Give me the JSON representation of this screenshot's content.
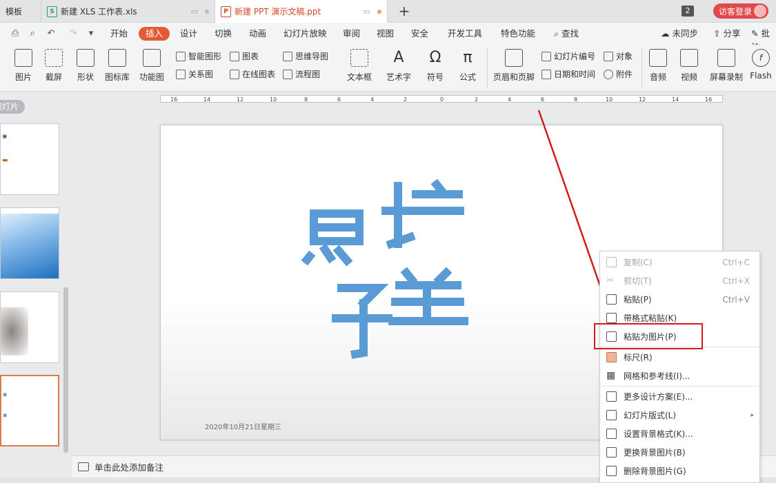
{
  "tabs": {
    "tab1": "模板",
    "tab2": "新建 XLS 工作表.xls",
    "tab3": "新建 PPT 演示文稿.ppt",
    "window_count": "2",
    "login": "访客登录"
  },
  "menu": {
    "items": [
      "开始",
      "插入",
      "设计",
      "切换",
      "动画",
      "幻灯片放映",
      "审阅",
      "视图",
      "安全",
      "开发工具",
      "特色功能"
    ],
    "search": "查找",
    "sync": "未同步",
    "share": "分享",
    "annotate": "批注"
  },
  "ribbon": {
    "picture": "图片",
    "screenshot": "截屏",
    "shapes": "形状",
    "icon_lib": "图标库",
    "func_chart": "功能图",
    "smart_shape": "智能图形",
    "chart": "图表",
    "relation": "关系图",
    "online_chart": "在线图表",
    "mindmap": "思维导图",
    "flowchart": "流程图",
    "textbox": "文本框",
    "art_text": "艺术字",
    "symbol": "符号",
    "formula": "公式",
    "header_footer": "页眉和页脚",
    "slide_number": "幻灯片编号",
    "object": "对象",
    "date_time": "日期和时间",
    "attachment": "附件",
    "audio": "音频",
    "video": "视频",
    "screen_record": "屏幕录制",
    "flash": "Flash"
  },
  "left_panel": {
    "tab_label": "幻灯片"
  },
  "ruler": {
    "ticks": [
      "16",
      "14",
      "12",
      "10",
      "8",
      "6",
      "4",
      "2",
      "0",
      "2",
      "4",
      "6",
      "8",
      "10",
      "12",
      "14",
      "16"
    ]
  },
  "slide": {
    "date": "2020年10月21日星期三"
  },
  "notes": {
    "placeholder": "单击此处添加备注"
  },
  "context_menu": {
    "copy": "复制(C)",
    "copy_shortcut": "Ctrl+C",
    "cut": "剪切(T)",
    "cut_shortcut": "Ctrl+X",
    "paste": "粘贴(P)",
    "paste_shortcut": "Ctrl+V",
    "paste_format": "带格式粘贴(K)",
    "paste_picture": "粘贴为图片(P)",
    "ruler": "标尺(R)",
    "grid": "网格和参考线(I)...",
    "more_design": "更多设计方案(E)...",
    "layout": "幻灯片版式(L)",
    "bg_format": "设置背景格式(K)...",
    "change_bg": "更换背景图片(B)",
    "delete_bg": "删除背景图片(G)"
  },
  "colors": {
    "accent": "#e35b35",
    "slide_text": "#5b9bd5",
    "annotation_red": "#d21c1c"
  }
}
